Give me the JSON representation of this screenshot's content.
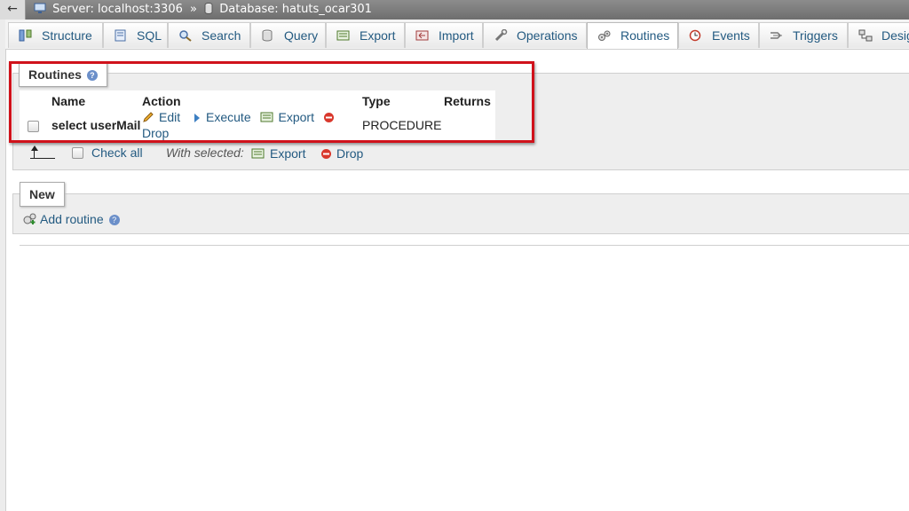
{
  "breadcrumb": {
    "back_label": "←",
    "server": "Server: localhost:3306",
    "separator": "»",
    "database": "Database: hatuts_ocar301"
  },
  "tabs": [
    {
      "label": "Structure",
      "icon": "structure-icon"
    },
    {
      "label": "SQL",
      "icon": "sql-icon"
    },
    {
      "label": "Search",
      "icon": "search-icon"
    },
    {
      "label": "Query",
      "icon": "query-icon"
    },
    {
      "label": "Export",
      "icon": "export-icon"
    },
    {
      "label": "Import",
      "icon": "import-icon"
    },
    {
      "label": "Operations",
      "icon": "wrench-icon"
    },
    {
      "label": "Routines",
      "icon": "routines-icon",
      "active": true
    },
    {
      "label": "Events",
      "icon": "clock-icon"
    },
    {
      "label": "Triggers",
      "icon": "triggers-icon"
    },
    {
      "label": "Desig",
      "icon": "designer-icon"
    }
  ],
  "routines_panel": {
    "legend": "Routines",
    "columns": {
      "name": "Name",
      "action": "Action",
      "type": "Type",
      "returns": "Returns"
    },
    "rows": [
      {
        "name": "select userMail",
        "actions": {
          "edit": "Edit",
          "execute": "Execute",
          "export": "Export",
          "drop": "Drop"
        },
        "type": "PROCEDURE",
        "returns": ""
      }
    ],
    "check_all": "Check all",
    "with_selected": "With selected:",
    "bulk_export": "Export",
    "bulk_drop": "Drop"
  },
  "new_panel": {
    "legend": "New",
    "add_routine": "Add routine"
  },
  "colors": {
    "link": "#235a81",
    "highlight": "#d0121b",
    "drop": "#d9382c"
  }
}
